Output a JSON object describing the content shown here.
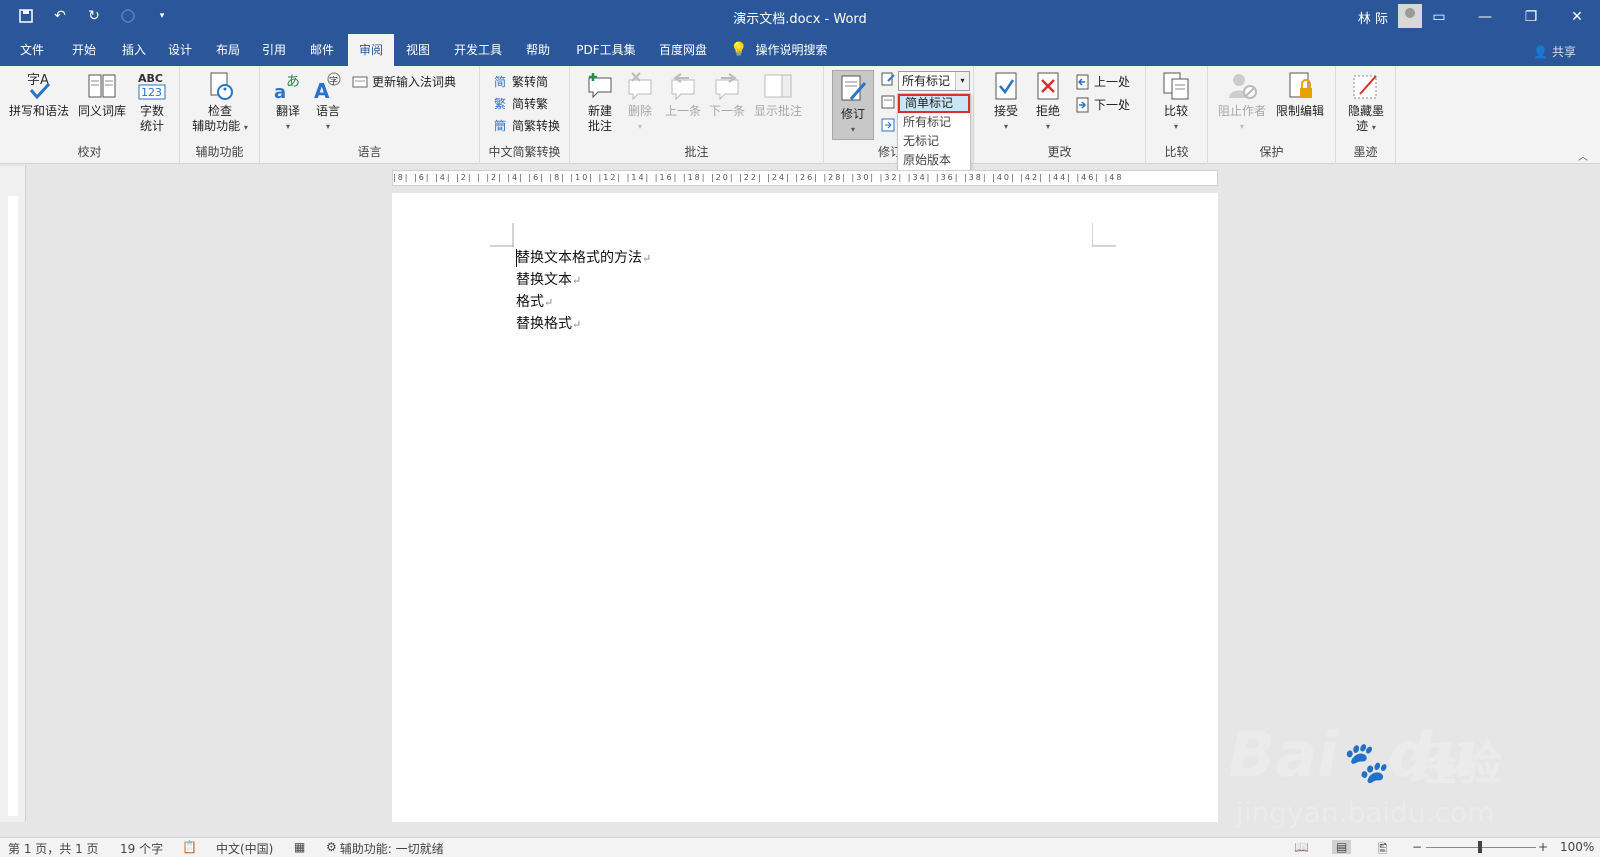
{
  "titlebar": {
    "title": "演示文档.docx  -  Word",
    "user": "林 际",
    "qat": [
      "save-icon",
      "undo-icon",
      "redo-icon",
      "circle-icon",
      "customize-icon"
    ]
  },
  "tabs": {
    "items": [
      "文件",
      "开始",
      "插入",
      "设计",
      "布局",
      "引用",
      "邮件",
      "审阅",
      "视图",
      "开发工具",
      "帮助",
      "PDF工具集",
      "百度网盘",
      "操作说明搜索"
    ],
    "active": "审阅",
    "share": "共享"
  },
  "ribbon": {
    "proofing": {
      "label": "校对",
      "spell": "拼写和语法",
      "thesaurus": "同义词库",
      "wordcount_line1": "字数",
      "wordcount_line2": "统计"
    },
    "accessibility": {
      "label": "辅助功能",
      "check_line1": "检查",
      "check_line2": "辅助功能"
    },
    "language": {
      "label": "语言",
      "translate": "翻译",
      "lang": "语言",
      "ime": "更新输入法词典"
    },
    "chinese": {
      "label": "中文简繁转换",
      "t2s": "繁转简",
      "s2t": "简转繁",
      "convert": "简繁转换"
    },
    "comments": {
      "label": "批注",
      "new_line1": "新建",
      "new_line2": "批注",
      "delete": "删除",
      "prev": "上一条",
      "next": "下一条",
      "show": "显示批注"
    },
    "tracking": {
      "label_visible": "修订",
      "track": "修订",
      "display_value": "所有标记"
    },
    "changes": {
      "label": "更改",
      "accept": "接受",
      "reject": "拒绝",
      "prev": "上一处",
      "next": "下一处"
    },
    "compare": {
      "label": "比较",
      "compare": "比较"
    },
    "protect": {
      "label": "保护",
      "block": "阻止作者",
      "restrict": "限制编辑"
    },
    "ink": {
      "label": "墨迹",
      "hide_line1": "隐藏墨",
      "hide_line2": "迹"
    }
  },
  "dropdown": {
    "options": [
      "简单标记",
      "所有标记",
      "无标记",
      "原始版本"
    ],
    "highlighted": "简单标记"
  },
  "ruler": {
    "text": "|8|  |6|  |4|  |2|  |  |2|  |4|  |6|  |8|  |10|  |12|  |14|  |16|  |18|  |20|  |22|  |24|  |26|  |28|  |30|  |32|  |34|  |36|  |38|  |40|  |42|  |44|  |46|  |48"
  },
  "document": {
    "lines": [
      "替换文本格式的方法",
      "替换文本",
      "格式",
      "替换格式"
    ],
    "pilcrow": "↵"
  },
  "watermark": {
    "brand": "Bai",
    "brand2": "du",
    "cn": "经验",
    "url": "jingyan.baidu.com"
  },
  "status": {
    "page": "第 1 页，共 1 页",
    "words": "19 个字",
    "lang": "中文(中国)",
    "accessibility": "辅助功能: 一切就绪",
    "zoom_minus": "−",
    "zoom_plus": "+",
    "zoom": "100%",
    "zoom_level": 1.0
  },
  "colors": {
    "brand": "#2b579a",
    "highlight_border": "#d9302c",
    "highlight_fill": "#cde4f7"
  }
}
